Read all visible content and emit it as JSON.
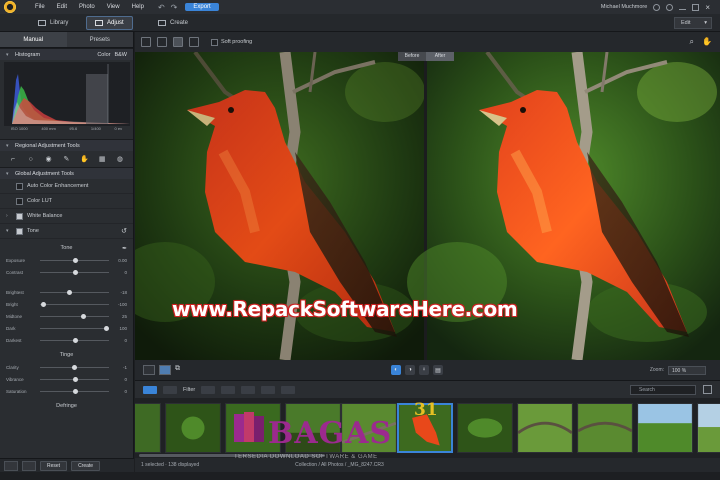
{
  "menu": {
    "items": [
      "File",
      "Edit",
      "Photo",
      "View",
      "Help"
    ],
    "export_label": "Export",
    "user_name": "Michael Muchmore"
  },
  "modes": {
    "library": "Library",
    "adjust": "Adjust",
    "create": "Create",
    "edit_dropdown": "Edit"
  },
  "left_panel": {
    "tab_manual": "Manual",
    "tab_presets": "Presets",
    "histogram_title": "Histogram",
    "color_label": "Color",
    "bw_label": "B&W",
    "exif": [
      "ISO 1000",
      "400 mm",
      "f/5.6",
      "1/400",
      "0 ev"
    ],
    "regional_title": "Regional Adjustment Tools",
    "global_title": "Global Adjustment Tools",
    "global_items": [
      "Auto Color Enhancement",
      "Color LUT",
      "White Balance",
      "Tone"
    ],
    "tone_title": "Tone",
    "tone_sliders": [
      {
        "label": "Exposure",
        "value": "0.00",
        "pos": 0.5
      },
      {
        "label": "Contrast",
        "value": "0",
        "pos": 0.5
      },
      {
        "label": "Brightest",
        "value": "-18",
        "pos": 0.42
      },
      {
        "label": "Bright",
        "value": "-100",
        "pos": 0.05
      },
      {
        "label": "Midtone",
        "value": "25",
        "pos": 0.62
      },
      {
        "label": "Dark",
        "value": "100",
        "pos": 0.95
      },
      {
        "label": "Darkest",
        "value": "0",
        "pos": 0.5
      }
    ],
    "tinge_title": "Tinge",
    "tinge_sliders": [
      {
        "label": "Clarity",
        "value": "-1",
        "pos": 0.49
      },
      {
        "label": "Vibrance",
        "value": "0",
        "pos": 0.5
      },
      {
        "label": "Saturation",
        "value": "0",
        "pos": 0.5
      }
    ],
    "defringe_title": "Defringe",
    "reset_label": "Reset",
    "create_label": "Create"
  },
  "viewer": {
    "soft_proofing": "Soft proofing",
    "before_label": "Before",
    "after_label": "After",
    "zoom_label": "Zoom:",
    "zoom_value": "100 %"
  },
  "filter": {
    "filter_label": "Filter",
    "search_placeholder": "Search"
  },
  "status": {
    "selected": "1 selected",
    "displayed": "138 displayed",
    "path": "Collection / All Photos / _MG_8247.CR3"
  },
  "watermarks": {
    "url": "www.RepackSoftwareHere.com",
    "bagas": "BAGAS",
    "bagas_num": "31",
    "bagas_sub": "TERSEDIA DOWNLOAD SOFTWARE & GAME"
  },
  "colors": {
    "accent": "#3a84d8",
    "panel": "#2a2d31",
    "bird": "#e8481a"
  }
}
